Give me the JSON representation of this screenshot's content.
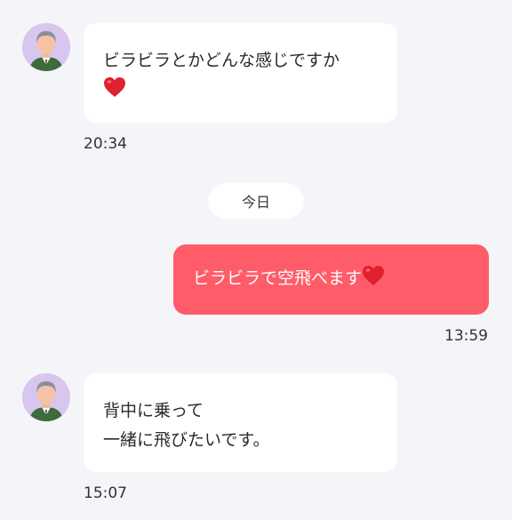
{
  "messages": [
    {
      "direction": "incoming",
      "avatar_icon": "man-avatar-icon",
      "line1": "ビラビラとかどんな感じですか",
      "emoji": "red-heart-icon",
      "time": "20:34"
    },
    {
      "direction": "outgoing",
      "text": "ビラビラで空飛べます",
      "emoji": "red-heart-icon",
      "time": "13:59"
    },
    {
      "direction": "incoming",
      "avatar_icon": "man-avatar-icon",
      "line1": "背中に乗って",
      "line2": "一緒に飛びたいです。",
      "time": "15:07"
    }
  ],
  "date_separator": "今日",
  "colors": {
    "background": "#f4f5f8",
    "incoming_bubble": "#ffffff",
    "outgoing_bubble": "#ff5c69",
    "avatar_bg": "#d9c6ee",
    "heart": "#e0202e"
  }
}
